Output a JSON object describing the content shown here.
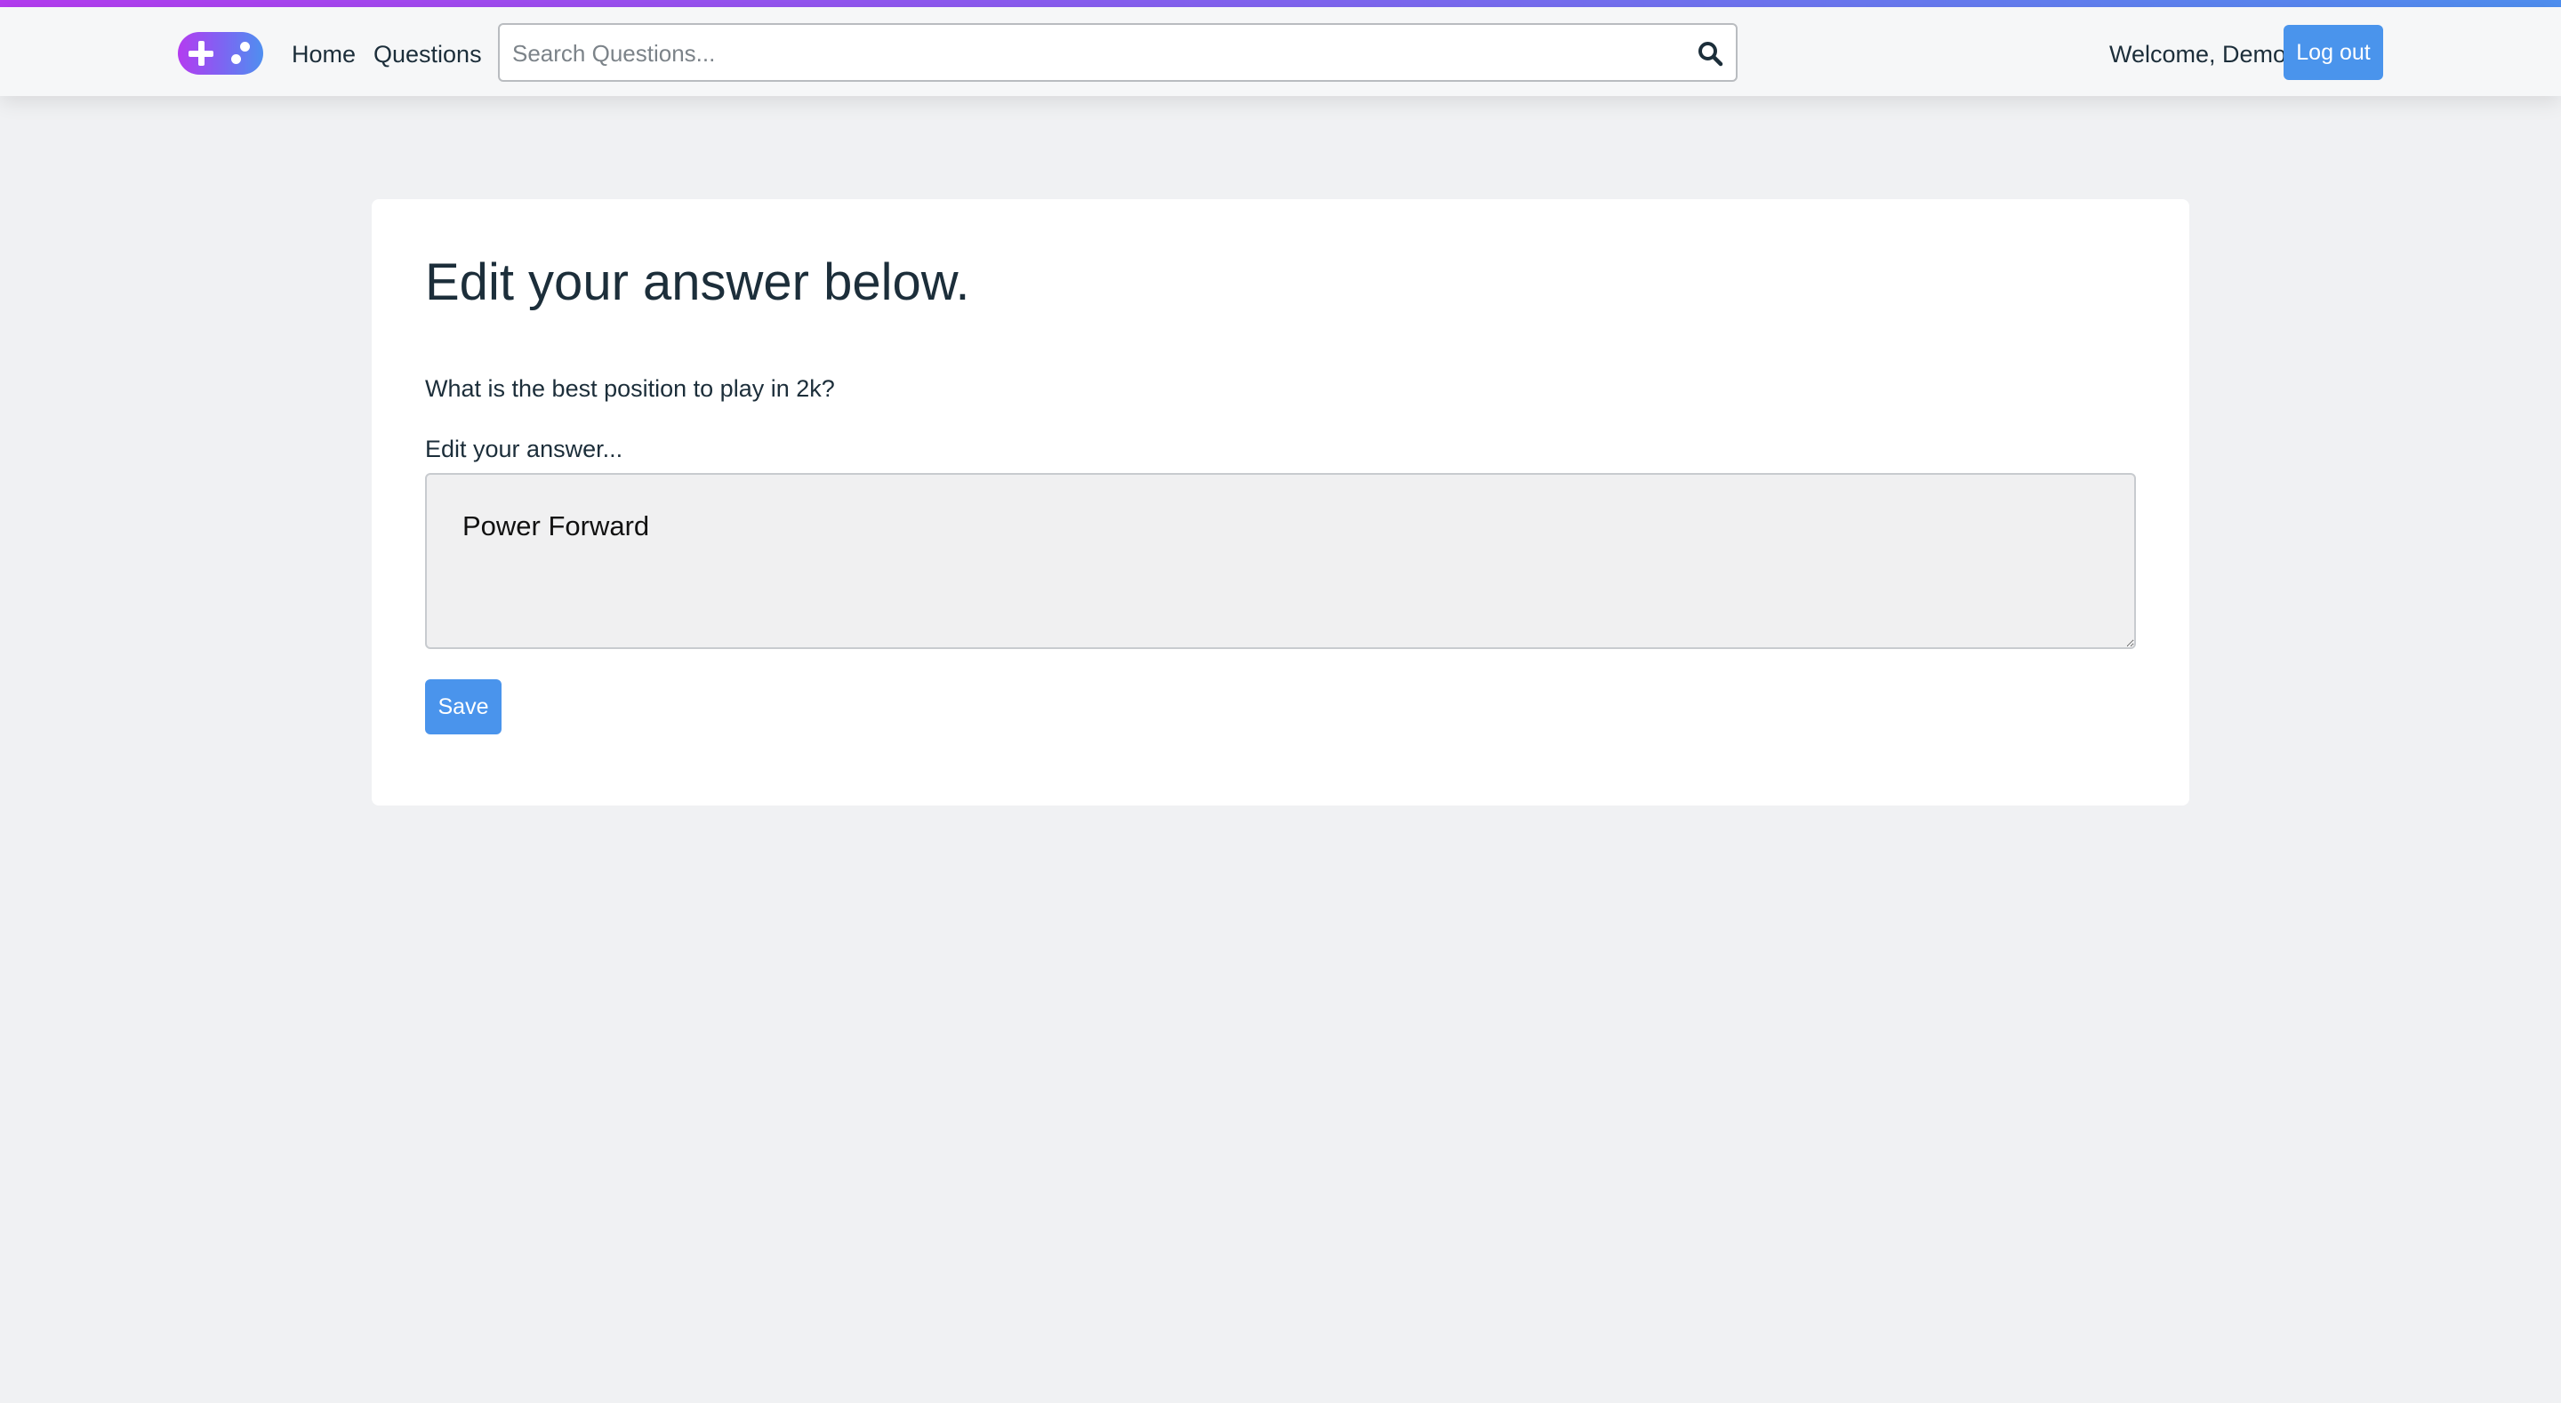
{
  "colors": {
    "accent_gradient_start": "#b43cf0",
    "accent_gradient_end": "#4f8ff0",
    "primary_button": "#4a94ec",
    "page_background": "#f0f1f3",
    "card_background": "#ffffff",
    "text": "#1c2e3a"
  },
  "header": {
    "logo_icon": "gamepad-icon",
    "nav": {
      "home": "Home",
      "questions": "Questions"
    },
    "search": {
      "placeholder": "Search Questions...",
      "value": "",
      "icon": "search-icon"
    },
    "welcome": "Welcome, Demo!",
    "logout_label": "Log out"
  },
  "main": {
    "title": "Edit your answer below.",
    "question": "What is the best position to play in 2k?",
    "answer_label": "Edit your answer...",
    "answer_value": "Power Forward",
    "save_label": "Save"
  }
}
